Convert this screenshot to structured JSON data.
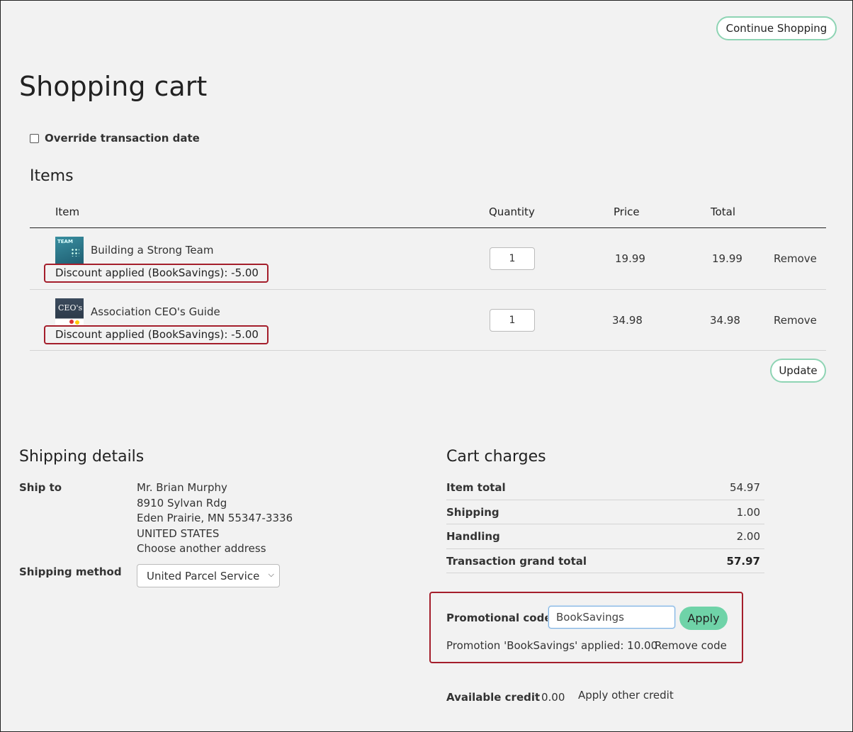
{
  "header": {
    "continue_label": "Continue Shopping",
    "title": "Shopping cart"
  },
  "override": {
    "label": "Override transaction date",
    "checked": false
  },
  "items_section": {
    "heading": "Items",
    "columns": {
      "item": "Item",
      "quantity": "Quantity",
      "price": "Price",
      "total": "Total"
    },
    "rows": [
      {
        "name": "Building a Strong Team",
        "discount": "Discount applied (BookSavings): -5.00",
        "quantity": "1",
        "price": "19.99",
        "total": "19.99",
        "remove": "Remove",
        "thumb_label": "TEAM"
      },
      {
        "name": "Association CEO's Guide",
        "discount": "Discount applied (BookSavings): -5.00",
        "quantity": "1",
        "price": "34.98",
        "total": "34.98",
        "remove": "Remove",
        "thumb_label": "CEO's"
      }
    ],
    "update_label": "Update"
  },
  "shipping": {
    "heading": "Shipping details",
    "ship_to_label": "Ship to",
    "address": [
      "Mr. Brian Murphy",
      "8910 Sylvan Rdg",
      "Eden Prairie, MN 55347-3336",
      "UNITED STATES"
    ],
    "choose_address": "Choose another address",
    "method_label": "Shipping method",
    "method_value": "United Parcel Service"
  },
  "charges": {
    "heading": "Cart charges",
    "rows": [
      {
        "label": "Item total",
        "value": "54.97"
      },
      {
        "label": "Shipping",
        "value": "1.00"
      },
      {
        "label": "Handling",
        "value": "2.00"
      },
      {
        "label": "Transaction grand total",
        "value": "57.97"
      }
    ]
  },
  "promo": {
    "label": "Promotional code",
    "value": "BookSavings",
    "apply_label": "Apply",
    "applied_text": "Promotion 'BookSavings' applied: 10.00",
    "remove_label": "Remove code"
  },
  "credit": {
    "label": "Available credit",
    "value": "0.00",
    "apply_other": "Apply other credit"
  },
  "colors": {
    "accent_border": "#8ed4b4",
    "apply_bg": "#6fd3a8",
    "highlight": "#a41e2b",
    "link": "#1b6b8a"
  }
}
